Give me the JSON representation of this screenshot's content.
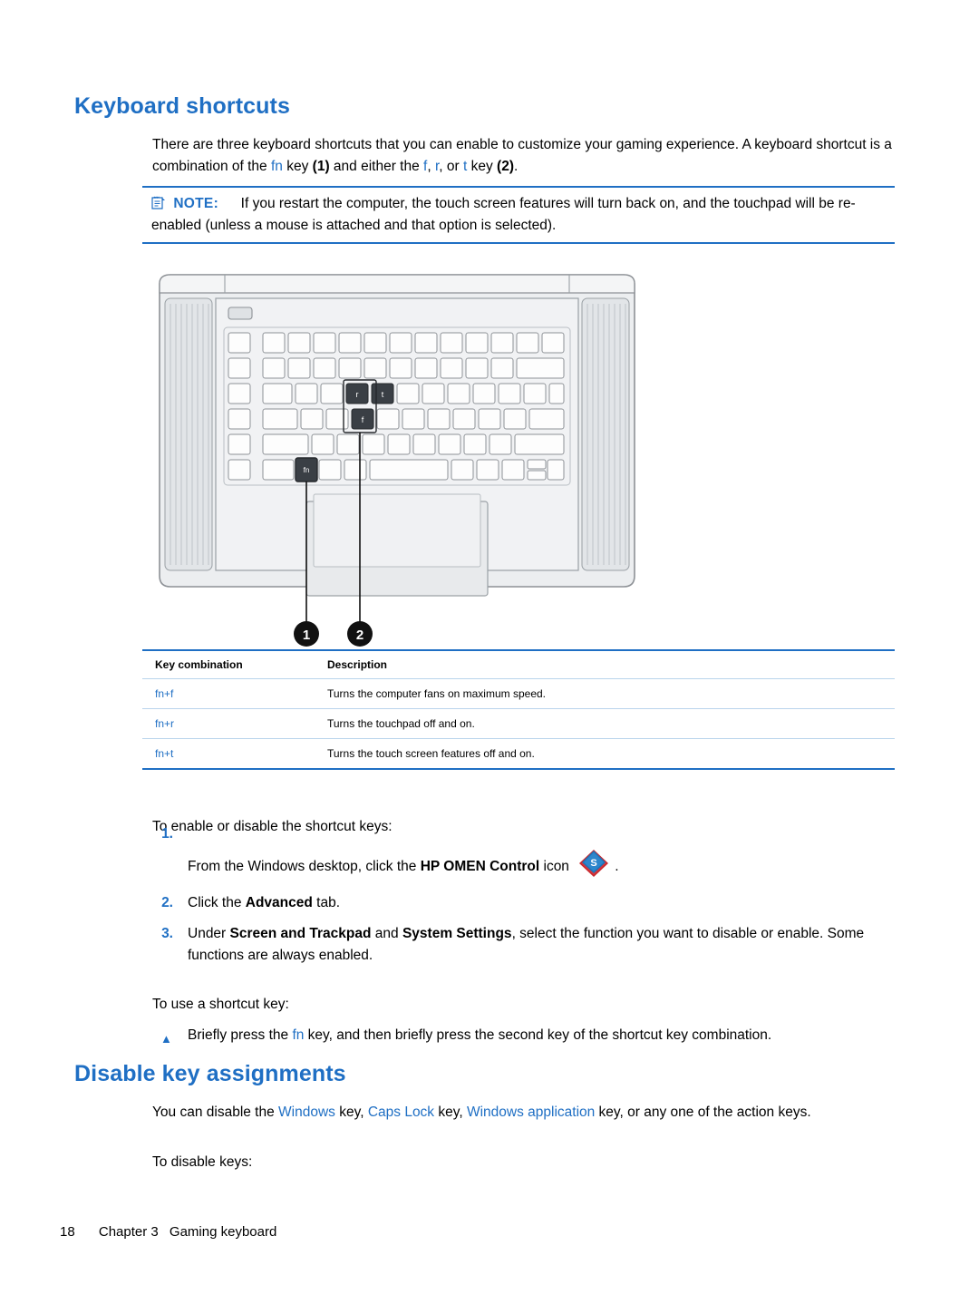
{
  "document": {
    "section_title": "Keyboard shortcuts",
    "intro": {
      "part1": "There are three keyboard shortcuts that you can enable to customize your gaming experience. A keyboard shortcut is a combination of the ",
      "fn": "fn",
      "part2": " key ",
      "one": "(1)",
      "part3": " and either the ",
      "f": "f",
      "comma1": ", ",
      "r": "r",
      "part4": ", or ",
      "t": "t",
      "part5": " key ",
      "two": "(2)",
      "period": "."
    },
    "note": {
      "label": "NOTE:",
      "text": "If you restart the computer, the touch screen features will turn back on, and the touchpad will be re-enabled (unless a mouse is attached and that option is selected)."
    },
    "callouts": {
      "one": "1",
      "two": "2",
      "key_fn": "fn",
      "key_f": "f",
      "key_r": "r",
      "key_t": "t"
    },
    "table": {
      "headers": [
        "Key combination",
        "Description"
      ],
      "rows": [
        {
          "combo": "fn+f",
          "description": "Turns the computer fans on maximum speed."
        },
        {
          "combo": "fn+r",
          "description": "Turns the touchpad off and on."
        },
        {
          "combo": "fn+t",
          "description": "Turns the touch screen features off and on."
        }
      ]
    },
    "enable_intro": "To enable or disable the shortcut keys:",
    "steps": [
      {
        "num": "1.",
        "text_before": "From the Windows desktop, click the ",
        "bold": "HP OMEN Control",
        "text_after": " icon ",
        "icon": "hp-omen-control-icon",
        "text_end": "."
      },
      {
        "num": "2.",
        "text_before": "Click the ",
        "bold": "Advanced",
        "text_after": " tab."
      },
      {
        "num": "3.",
        "text_before": "Under ",
        "bold": "Screen and Trackpad",
        "text_mid": " and ",
        "bold2": "System Settings",
        "text_after": ", select the function you want to disable or enable. Some functions are always enabled."
      }
    ],
    "use_intro": "To use a shortcut key:",
    "use_bullet": {
      "before": "Briefly press the ",
      "key": "fn",
      "after": " key, and then briefly press the second key of the shortcut key combination."
    },
    "section_title_2": "Disable key assignments",
    "disable_para": {
      "before": "You can disable the ",
      "link1": "Windows",
      "mid1": " key, ",
      "link2": "Caps Lock",
      "mid2": " key, ",
      "link3": "Windows application",
      "after": " key, or any one of the action keys."
    },
    "disable_intro": "To disable keys:",
    "footer": {
      "page": "18",
      "chapter": "Chapter 3",
      "title": "Gaming keyboard"
    },
    "colors": {
      "accent": "#1f6fc4",
      "rule": "#b9d4ec",
      "text": "#000000",
      "laptop_body": "#e9ebed",
      "laptop_outline": "#8d9196",
      "key_highlight": "#3a3f45"
    }
  }
}
